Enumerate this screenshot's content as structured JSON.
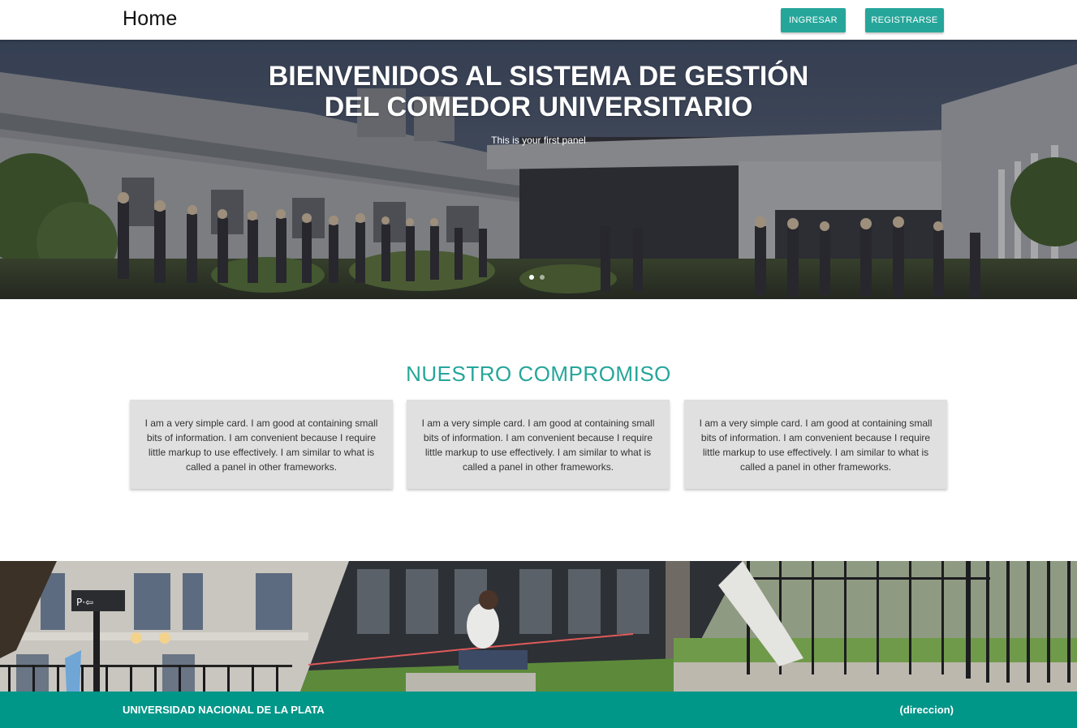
{
  "navbar": {
    "brand": "Home",
    "login_label": "INGRESAR",
    "register_label": "REGISTRARSE",
    "button_color": "#26a69a"
  },
  "hero": {
    "title_line1": "BIENVENIDOS AL SISTEMA DE GESTIÓN",
    "title_line2": "DEL COMEDOR UNIVERSITARIO",
    "subtitle": "This is your first panel",
    "slide_count": 2,
    "active_slide": 1
  },
  "section": {
    "title": "NUESTRO COMPROMISO",
    "title_color": "#26a69a",
    "cards": [
      {
        "text": "I am a very simple card. I am good at containing small bits of information. I am convenient because I require little markup to use effectively. I am similar to what is called a panel in other frameworks."
      },
      {
        "text": "I am a very simple card. I am good at containing small bits of information. I am convenient because I require little markup to use effectively. I am similar to what is called a panel in other frameworks."
      },
      {
        "text": "I am a very simple card. I am good at containing small bits of information. I am convenient because I require little markup to use effectively. I am similar to what is called a panel in other frameworks."
      }
    ]
  },
  "footer": {
    "left": "UNIVERSIDAD NACIONAL DE LA PLATA",
    "right": "(direccion)",
    "background": "#009688"
  }
}
